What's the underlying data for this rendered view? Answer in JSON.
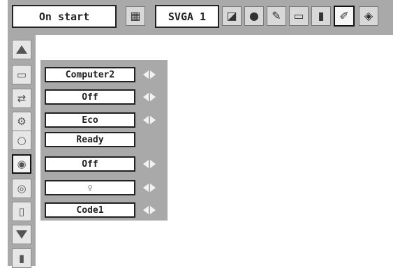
{
  "topbar": {
    "mode_label": "On start",
    "signal_label": "SVGA 1",
    "icons": [
      "picture-adjust-icon",
      "image-select-icon",
      "color-adjust-icon",
      "screen-icon",
      "sound-icon",
      "setting-icon",
      "expand-icon"
    ]
  },
  "sidebar": {
    "icons": [
      "scroll-up-icon",
      "input-icon",
      "power-icon",
      "lamp-mode-icon",
      "lamp-status-icon",
      "standby-icon",
      "lamp-counter-icon",
      "remote-icon",
      "scroll-down-icon",
      "exit-icon"
    ]
  },
  "settings": {
    "rows": [
      {
        "value": "Computer2",
        "arrows": true
      },
      {
        "value": "Off",
        "arrows": true
      },
      {
        "value": "Eco",
        "arrows": true
      },
      {
        "value": "Ready",
        "arrows": false
      },
      {
        "value": "Off",
        "arrows": true
      },
      {
        "value": "",
        "arrows": true,
        "icon": "bulb-icon"
      },
      {
        "value": "Code1",
        "arrows": true
      }
    ]
  },
  "colors": {
    "menu_gray": "#a9a9a9",
    "field_bg": "#ffffff",
    "border": "#222222"
  }
}
